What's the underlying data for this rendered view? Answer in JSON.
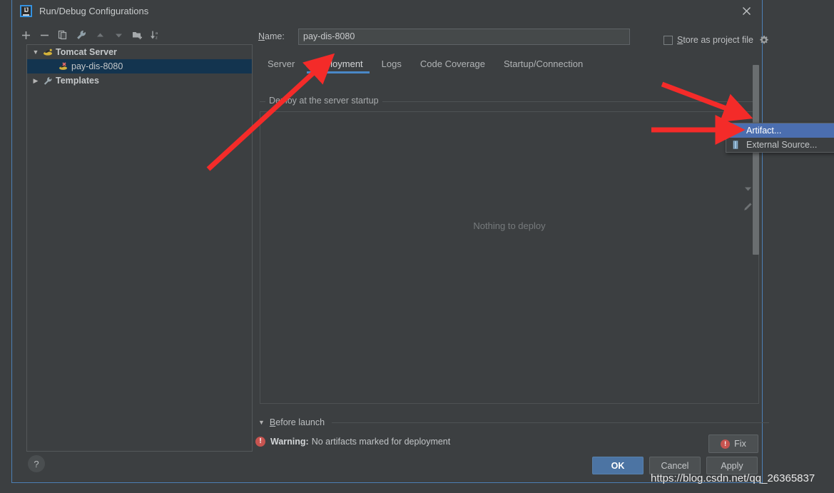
{
  "window": {
    "title": "Run/Debug Configurations",
    "app_icon": "intellij-idea-icon",
    "close_icon": "close-icon"
  },
  "left_toolbar": {
    "buttons": [
      {
        "name": "add-configuration-button",
        "icon": "plus-icon",
        "label": "+"
      },
      {
        "name": "remove-configuration-button",
        "icon": "minus-icon",
        "label": "−"
      },
      {
        "name": "copy-configuration-button",
        "icon": "copy-icon",
        "label": "Copy"
      },
      {
        "name": "edit-templates-button",
        "icon": "wrench-icon",
        "label": "Edit defaults"
      },
      {
        "name": "move-up-button",
        "icon": "arrow-up-icon",
        "label": "Move Up"
      },
      {
        "name": "move-down-button",
        "icon": "arrow-down-icon",
        "label": "Move Down"
      },
      {
        "name": "move-into-folder-button",
        "icon": "new-folder-icon",
        "label": "Create folder"
      },
      {
        "name": "sort-configurations-button",
        "icon": "sort-az-icon",
        "label": "Sort"
      }
    ]
  },
  "tree": {
    "nodes": [
      {
        "label": "Tomcat Server",
        "icon": "tomcat-icon",
        "expanded": true,
        "arrow": "▼",
        "level": 0,
        "selected": false
      },
      {
        "label": "pay-dis-8080",
        "icon": "tomcat-run-icon",
        "arrow": "",
        "level": 1,
        "selected": true
      },
      {
        "label": "Templates",
        "icon": "wrench-icon",
        "expanded": false,
        "arrow": "▶",
        "level": 0,
        "selected": false
      }
    ]
  },
  "form": {
    "name_label": "Name:",
    "name_label_mnemonic": "N",
    "name_value": "pay-dis-8080",
    "name_placeholder": "",
    "store_as_project_file": {
      "label": "Store as project file",
      "mnemonic": "S",
      "checked": false,
      "gear_icon": "gear-icon"
    }
  },
  "tabs": [
    {
      "label": "Server",
      "active": false
    },
    {
      "label": "Deployment",
      "active": true
    },
    {
      "label": "Logs",
      "active": false
    },
    {
      "label": "Code Coverage",
      "active": false
    },
    {
      "label": "Startup/Connection",
      "active": false
    }
  ],
  "deployment": {
    "group_title": "Deploy at the server startup",
    "empty_text": "Nothing to deploy",
    "toolbar": [
      {
        "name": "add-deployment-button",
        "icon": "plus-icon",
        "label": "+",
        "enabled": true
      },
      {
        "name": "move-down-deployment-button",
        "icon": "arrow-down-icon",
        "label": "▼",
        "enabled": false
      },
      {
        "name": "edit-deployment-button",
        "icon": "pencil-icon",
        "label": "Edit",
        "enabled": false
      }
    ]
  },
  "popup_menu": {
    "items": [
      {
        "label": "Artifact...",
        "icon": "artifact-icon",
        "selected": true
      },
      {
        "label": "External Source...",
        "icon": "external-source-icon",
        "selected": false
      }
    ]
  },
  "before_launch": {
    "arrow": "▼",
    "label": "Before launch",
    "mnemonic": "B"
  },
  "warning": {
    "icon": "error-icon",
    "prefix": "Warning:",
    "message": "No artifacts marked for deployment",
    "fix_label": "Fix",
    "fix_icon": "error-icon"
  },
  "footer": {
    "help_label": "?",
    "ok_label": "OK",
    "cancel_label": "Cancel",
    "apply_label": "Apply"
  },
  "watermark": {
    "text": "https://blog.csdn.net/qq_26365837"
  },
  "colors": {
    "window_bg": "#3c3f41",
    "border": "#4d7fb5",
    "accent_blue": "#4a88c7",
    "selection_blue": "#4b6eaf",
    "tree_selection": "#13344f",
    "warning_red": "#c75450",
    "primary_button": "#4c74a3",
    "annotation_red": "#f42b29"
  }
}
